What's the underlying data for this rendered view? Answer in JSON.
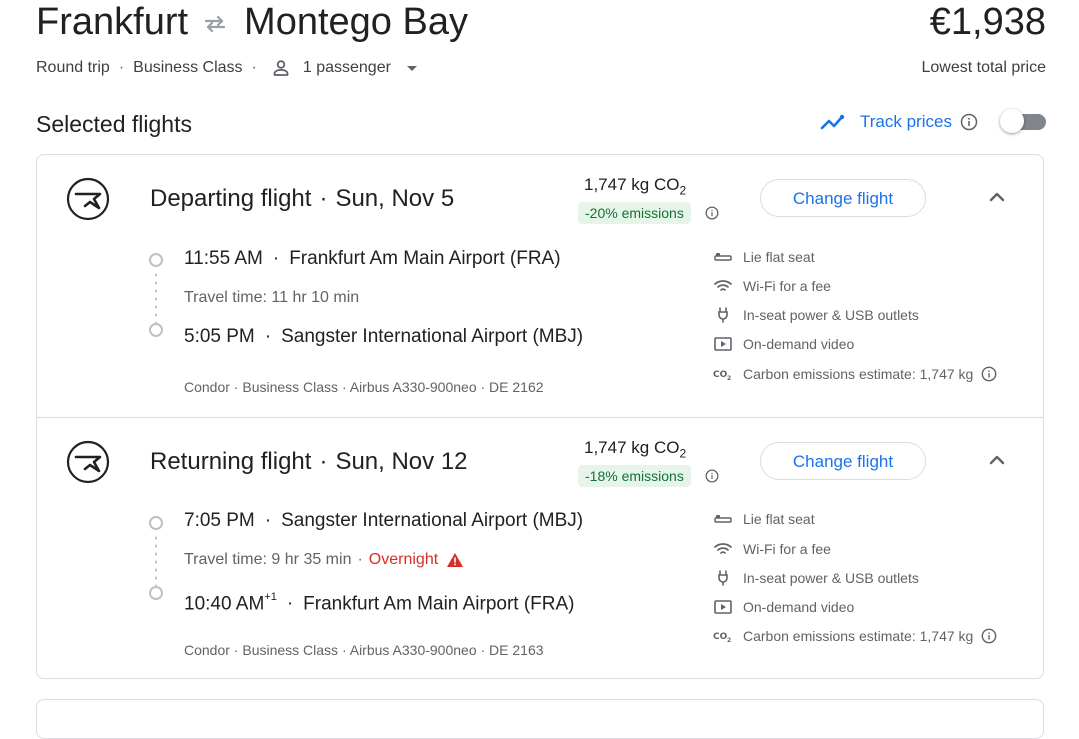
{
  "header": {
    "origin": "Frankfurt",
    "destination": "Montego Bay",
    "price": "€1,938",
    "price_label": "Lowest total price",
    "trip_type": "Round trip",
    "cabin": "Business Class",
    "passengers": "1 passenger"
  },
  "selected": {
    "title": "Selected flights",
    "track_prices": "Track prices",
    "track_prices_enabled": false
  },
  "flights": [
    {
      "direction": "Departing flight",
      "date": "Sun, Nov 5",
      "co2_value": "1,747 kg CO",
      "co2_sub": "2",
      "emissions_badge": "-20% emissions",
      "change_label": "Change flight",
      "depart_time": "11:55 AM",
      "depart_airport": "Frankfurt Am Main Airport (FRA)",
      "travel_time": "Travel time: 11 hr 10 min",
      "overnight": "",
      "arrive_time": "5:05 PM",
      "arrive_plus": "",
      "arrive_airport": "Sangster International Airport (MBJ)",
      "details": "Condor · Business Class · Airbus A330-900neo · DE 2162",
      "amenities": [
        "Lie flat seat",
        "Wi-Fi for a fee",
        "In-seat power & USB outlets",
        "On-demand video",
        "Carbon emissions estimate: 1,747 kg"
      ]
    },
    {
      "direction": "Returning flight",
      "date": "Sun, Nov 12",
      "co2_value": "1,747 kg CO",
      "co2_sub": "2",
      "emissions_badge": "-18% emissions",
      "change_label": "Change flight",
      "depart_time": "7:05 PM",
      "depart_airport": "Sangster International Airport (MBJ)",
      "travel_time": "Travel time: 9 hr 35 min",
      "overnight": "Overnight",
      "arrive_time": "10:40 AM",
      "arrive_plus": "+1",
      "arrive_airport": "Frankfurt Am Main Airport (FRA)",
      "details": "Condor · Business Class · Airbus A330-900neo · DE 2163",
      "amenities": [
        "Lie flat seat",
        "Wi-Fi for a fee",
        "In-seat power & USB outlets",
        "On-demand video",
        "Carbon emissions estimate: 1,747 kg"
      ]
    }
  ],
  "icons": {
    "swap": "swap-arrows-icon",
    "person": "person-icon",
    "caret": "caret-down-icon",
    "trend": "trending-line-icon",
    "info": "info-icon",
    "airline_logo": "condor-logo",
    "chevron": "chevron-up-icon",
    "warning": "warning-icon",
    "amenity_icons": [
      "seat-icon",
      "wifi-icon",
      "power-plug-icon",
      "video-icon",
      "co2-icon"
    ]
  },
  "colors": {
    "accent": "#1a73e8",
    "emissions_bg": "#e6f4ea",
    "emissions_text": "#137333",
    "warning": "#d93025"
  }
}
